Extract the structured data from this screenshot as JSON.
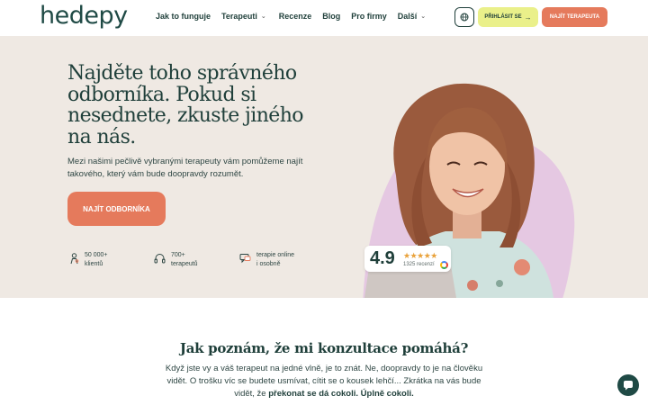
{
  "header": {
    "logo": "hedepy",
    "nav": [
      {
        "label": "Jak to funguje",
        "dropdown": false
      },
      {
        "label": "Terapeuti",
        "dropdown": true
      },
      {
        "label": "Recenze",
        "dropdown": false
      },
      {
        "label": "Blog",
        "dropdown": false
      },
      {
        "label": "Pro firmy",
        "dropdown": false
      },
      {
        "label": "Další",
        "dropdown": true
      }
    ],
    "language_icon": "globe-icon",
    "login_label": "PŘIHLÁSIT SE",
    "find_label": "NAJÍT TERAPEUTA"
  },
  "hero": {
    "title": "Najděte toho správného odborníka. Pokud si nesednete, zkuste jiného na nás.",
    "subtitle": "Mezi našimi pečlivě vybranými terapeuty vám pomůžeme najít takového, který vám bude doopravdy rozumět.",
    "cta_label": "NAJÍT ODBORNÍKA",
    "stats": [
      {
        "icon": "person-icon",
        "line1": "50 000+",
        "line2": "klientů"
      },
      {
        "icon": "headphones-icon",
        "line1": "700+",
        "line2": "terapeutů"
      },
      {
        "icon": "chat-icon",
        "line1": "terapie online",
        "line2": "i osobně"
      }
    ],
    "rating": {
      "value": "4.9",
      "stars": "★★★★★",
      "reviews": "1325 recenzí"
    }
  },
  "section": {
    "title": "Jak poznám, že mi konzultace pomáhá?",
    "text_plain": "Když jste vy a váš terapeut na jedné vlně, je to znát. Ne, doopravdy to je na člověku vidět. O trošku víc se budete usmívat, cítit se o kousek lehčí... Zkrátka na vás bude vidět, že",
    "text_bold": "překonat se dá cokoli. Úplně cokoli."
  },
  "colors": {
    "primary": "#1f3f3a",
    "accent": "#e57a5c",
    "login_bg": "#eaf08a",
    "hero_bg": "#efe9e3",
    "blob": "#e3c6e0"
  }
}
